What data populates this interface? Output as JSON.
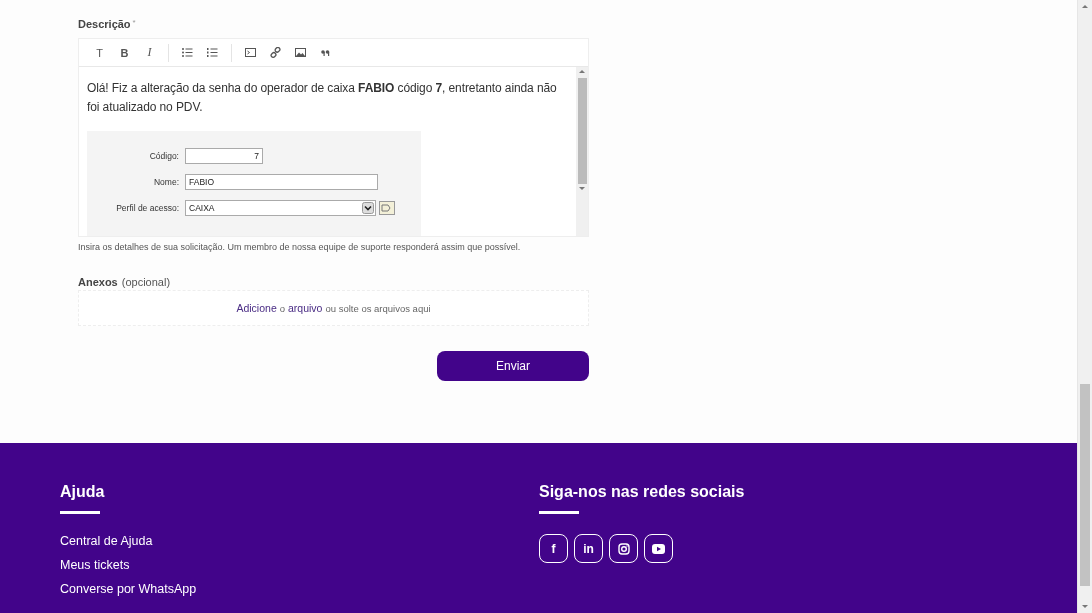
{
  "form": {
    "description_label": "Descrição",
    "required_mark": "*",
    "toolbar": [
      {
        "glyph": "T",
        "kind": "text"
      },
      {
        "glyph": "B",
        "kind": "text"
      },
      {
        "glyph": "I",
        "kind": "text"
      },
      {
        "kind": "divider"
      },
      {
        "kind": "bullets"
      },
      {
        "kind": "numbers"
      },
      {
        "kind": "divider"
      },
      {
        "kind": "code"
      },
      {
        "kind": "link"
      },
      {
        "kind": "image"
      },
      {
        "kind": "quote"
      }
    ],
    "message": "Olá! Fiz a alteração da senha do operador de caixa **FABIO** código **7**, entretanto ainda não foi atualizado no PDV.",
    "embedded": {
      "fields": [
        {
          "label": "Código:",
          "value": "7",
          "kind": "number"
        },
        {
          "label": "Nome:",
          "value": "FABIO",
          "kind": "text"
        },
        {
          "label": "Perfil de acesso:",
          "value": "CAIXA",
          "kind": "select"
        }
      ]
    },
    "hint": "Insira os detalhes de sua solicitação. Um membro de nossa equipe de suporte responderá assim que possível.",
    "attachments_label": "Anexos",
    "attachments_optional": "(opcional)",
    "dropzone": {
      "link1": "Adicione",
      "mid": "o",
      "link2": "arquivo",
      "rest": "ou solte os arquivos aqui"
    },
    "submit": "Enviar"
  },
  "footer": {
    "help": {
      "title": "Ajuda",
      "links": [
        "Central de Ajuda",
        "Meus tickets",
        "Converse por WhatsApp"
      ]
    },
    "social": {
      "title": "Siga-nos nas redes sociais",
      "items": [
        {
          "kind": "text",
          "glyph": "f"
        },
        {
          "kind": "text",
          "glyph": "in"
        },
        {
          "kind": "camera"
        },
        {
          "kind": "play"
        }
      ]
    }
  }
}
